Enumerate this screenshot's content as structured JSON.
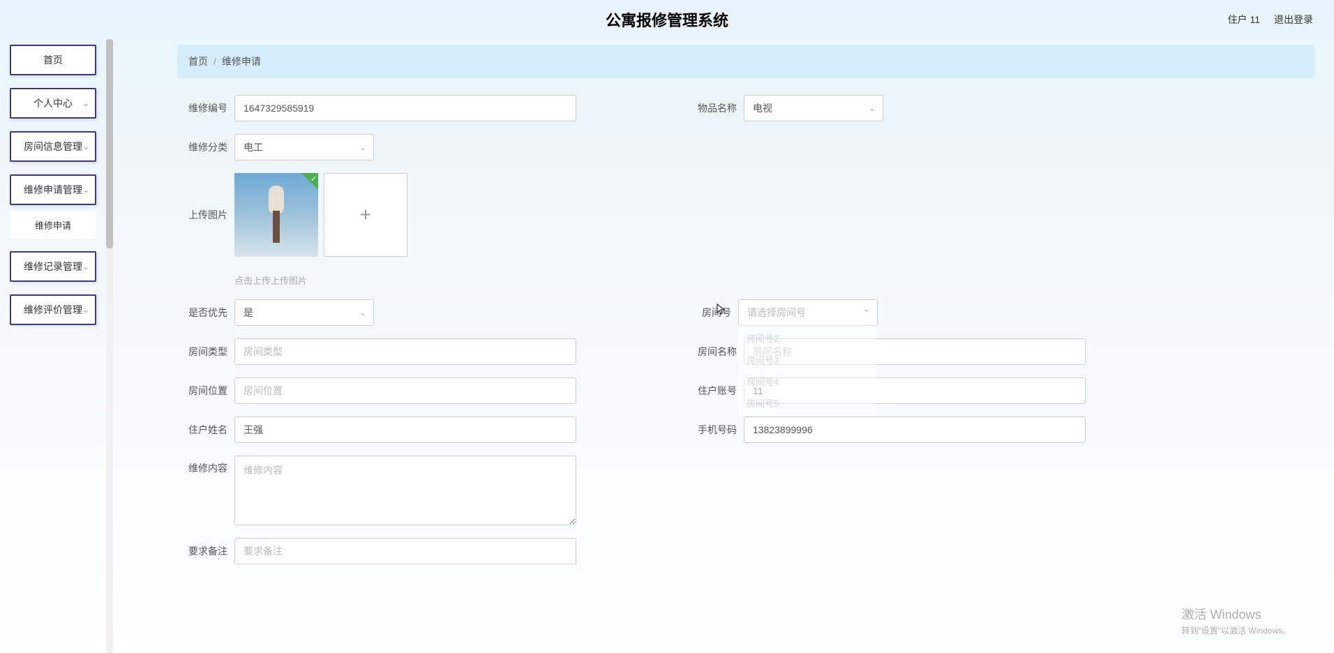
{
  "header": {
    "title": "公寓报修管理系统",
    "user_label": "住户 11",
    "logout": "退出登录"
  },
  "sidebar": {
    "home": "首页",
    "personal": "个人中心",
    "room_mgmt": "房间信息管理",
    "repair_apply_mgmt": "维修申请管理",
    "repair_apply": "维修申请",
    "repair_record_mgmt": "维修记录管理",
    "repair_review_mgmt": "维修评价管理"
  },
  "breadcrumb": {
    "home": "首页",
    "current": "维修申请"
  },
  "form": {
    "repair_no_label": "维修编号",
    "repair_no_value": "1647329585919",
    "item_name_label": "物品名称",
    "item_name_value": "电视",
    "category_label": "维修分类",
    "category_value": "电工",
    "upload_label": "上传图片",
    "upload_hint": "点击上传上传图片",
    "priority_label": "是否优先",
    "priority_value": "是",
    "room_no_label": "房间号",
    "room_no_placeholder": "请选择房间号",
    "room_type_label": "房间类型",
    "room_type_placeholder": "房间类型",
    "room_name_label": "房间名称",
    "room_name_placeholder": "房间名称",
    "room_loc_label": "房间位置",
    "room_loc_placeholder": "房间位置",
    "account_label": "住户账号",
    "account_value": "11",
    "resident_name_label": "住户姓名",
    "resident_name_value": "王强",
    "phone_label": "手机号码",
    "phone_value": "13823899996",
    "content_label": "维修内容",
    "content_placeholder": "维修内容",
    "remark_label": "要求备注",
    "remark_placeholder": "要求备注"
  },
  "dropdown": {
    "opt2": "房间号2",
    "opt3": "房间号3",
    "opt4": "房间号4",
    "opt5": "房间号5"
  },
  "watermark": {
    "title": "激活 Windows",
    "sub": "转到\"设置\"以激活 Windows。"
  }
}
